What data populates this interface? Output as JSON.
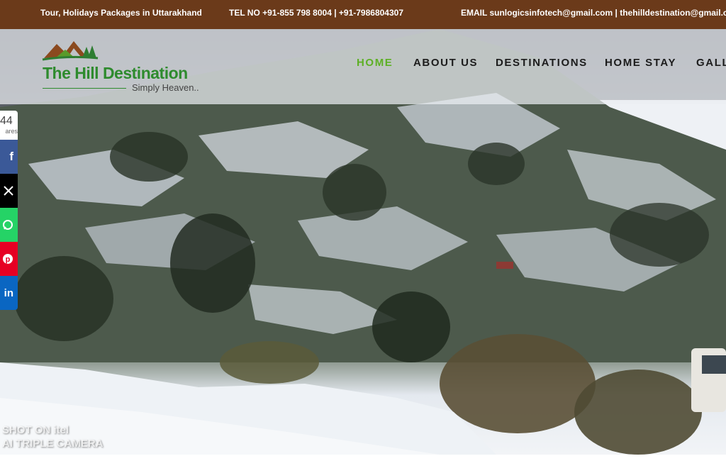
{
  "topbar": {
    "tagline": "Tour, Holidays Packages in Uttarakhand",
    "tel": "TEL NO +91-855 798 8004 | +91-7986804307",
    "email": "EMAIL sunlogicsinfotech@gmail.com | thehilldestination@gmail.com"
  },
  "logo": {
    "title": "The Hill Destination",
    "tagline": "Simply Heaven..",
    "icon": "mountain-logo-icon"
  },
  "nav": {
    "items": [
      {
        "label": "HOME",
        "active": true
      },
      {
        "label": "ABOUT US",
        "active": false
      },
      {
        "label": "DESTINATIONS",
        "active": false
      },
      {
        "label": "HOME STAY",
        "active": false
      },
      {
        "label": "GALL",
        "active": false
      }
    ],
    "active_color": "#5db025"
  },
  "share": {
    "count": "44",
    "label": "ares",
    "buttons": [
      {
        "icon": "facebook-icon",
        "glyph": "f",
        "color": "#3b5998"
      },
      {
        "icon": "x-icon",
        "glyph": "X",
        "color": "#000000"
      },
      {
        "icon": "whatsapp-icon",
        "glyph": "",
        "color": "#25d366"
      },
      {
        "icon": "pinterest-icon",
        "glyph": "p",
        "color": "#e60023"
      },
      {
        "icon": "linkedin-icon",
        "glyph": "in",
        "color": "#0a66c2"
      }
    ]
  },
  "hero": {
    "watermark_line1": "SHOT ON itel",
    "watermark_line2": "AI TRIPLE CAMERA"
  },
  "colors": {
    "topbar_bg": "#6b3a1a",
    "logo_green": "#2e8b2e"
  }
}
